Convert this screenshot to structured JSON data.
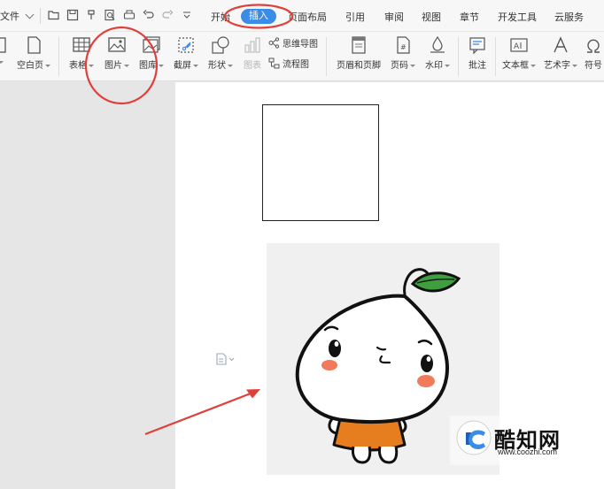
{
  "menu": {
    "file_label": "文件",
    "tabs": [
      "开始",
      "插入",
      "页面布局",
      "引用",
      "审阅",
      "视图",
      "章节",
      "开发工具",
      "云服务"
    ],
    "active_tab": "插入"
  },
  "ribbon": {
    "blank_page": "空白页",
    "table": "表格",
    "picture": "图片",
    "gallery": "图库",
    "screenshot": "截屏",
    "shapes": "形状",
    "chart": "图表",
    "mind_map": "思维导图",
    "flowchart": "流程图",
    "header_footer": "页眉和页脚",
    "page_number": "页码",
    "watermark": "水印",
    "comment": "批注",
    "textbox": "文本框",
    "wordart": "艺术字",
    "symbol": "符号"
  },
  "watermark_overlay": {
    "title": "酷知网",
    "url": "www.coozhi.com"
  },
  "colors": {
    "accent": "#3b8ce6",
    "annotation_red": "#e0403a",
    "leaf_green": "#3f9e3f",
    "dress_orange": "#e67d1e"
  }
}
